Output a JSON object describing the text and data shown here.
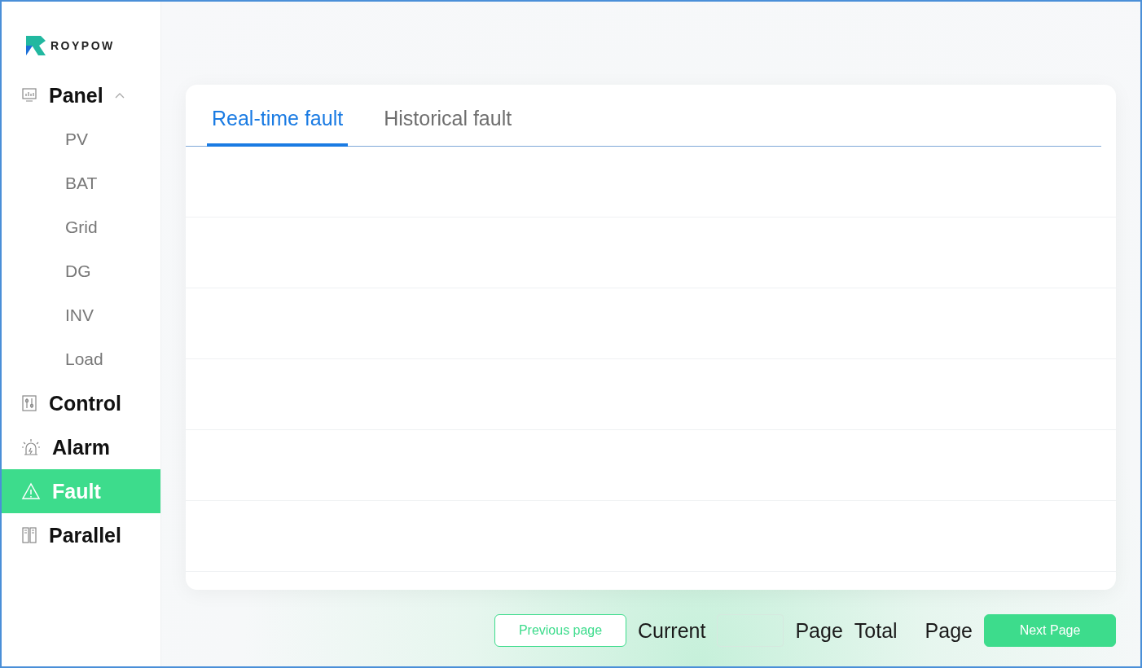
{
  "logo": {
    "text": "ROYPOW"
  },
  "sidebar": {
    "items": [
      {
        "label": "Panel",
        "selected": false,
        "expanded": true,
        "children": [
          {
            "label": "PV",
            "selected": false
          },
          {
            "label": "BAT",
            "selected": false
          },
          {
            "label": "Grid",
            "selected": false
          },
          {
            "label": "DG",
            "selected": false
          },
          {
            "label": "INV",
            "selected": false
          },
          {
            "label": "Load",
            "selected": false
          }
        ]
      },
      {
        "label": "Control",
        "selected": false
      },
      {
        "label": "Alarm",
        "selected": false
      },
      {
        "label": "Fault",
        "selected": true
      },
      {
        "label": "Parallel",
        "selected": false
      }
    ]
  },
  "tabs": [
    {
      "label": "Real-time fault",
      "selected": true
    },
    {
      "label": "Historical fault",
      "selected": false
    }
  ],
  "pagination": {
    "previous": "Previous page",
    "current_label": "Current",
    "current_unit": "Page",
    "total_label": "Total",
    "total_unit": "Page",
    "next": "Next Page"
  }
}
